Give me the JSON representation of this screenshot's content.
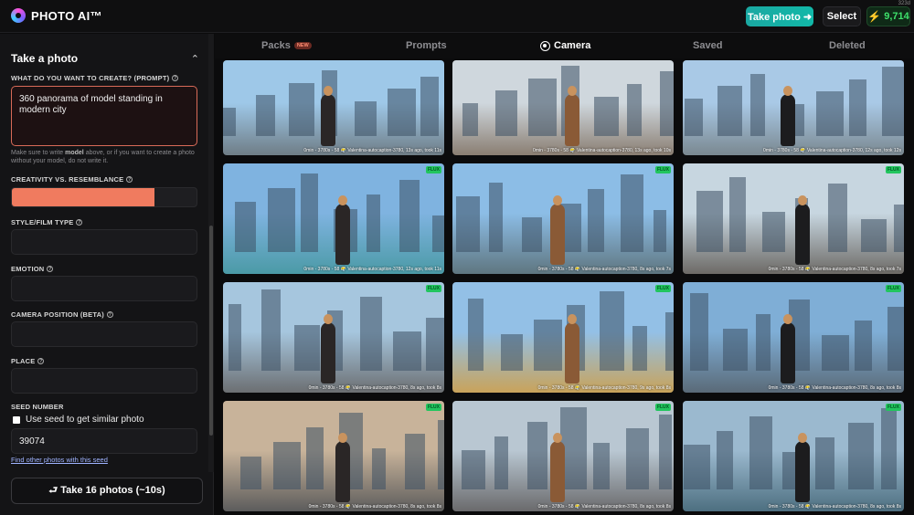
{
  "app": {
    "name": "PHOTO AI™",
    "corner_id": "323d"
  },
  "header": {
    "take_photo_label": "Take photo ➜",
    "select_label": "Select",
    "credits": "9,714"
  },
  "sidebar": {
    "panel_title": "Take a photo",
    "prompt_label": "WHAT DO YOU WANT TO CREATE? (PROMPT)",
    "prompt_value": "360 panorama of model standing in modern city",
    "prompt_hint_before": "Make sure to write ",
    "prompt_hint_bold": "model",
    "prompt_hint_after": " above, or if you want to create a photo without your model, do not write it.",
    "creativity_label": "CREATIVITY VS. RESEMBLANCE",
    "creativity_value": 0.77,
    "style_label": "STYLE/FILM TYPE",
    "style_value": "",
    "emotion_label": "EMOTION",
    "emotion_value": "",
    "camera_label": "CAMERA POSITION (BETA)",
    "camera_value": "",
    "place_label": "PLACE",
    "place_value": "",
    "seed_label": "SEED NUMBER",
    "seed_checkbox_label": "Use seed to get similar photo",
    "seed_value": "39074",
    "find_link": "Find other photos with this seed",
    "take_button": "⮐ Take 16 photos (~10s)"
  },
  "tabs": [
    {
      "label": "Packs",
      "badge": "NEW"
    },
    {
      "label": "Prompts"
    },
    {
      "label": "Camera",
      "active": true
    },
    {
      "label": "Saved"
    },
    {
      "label": "Deleted"
    }
  ],
  "tile_badge": "FLUX",
  "tiles": [
    {
      "caption": "0min - 3780s - 58 😶‍🌫️ Valentina-autocaption-3780, 13s ago, took 11s",
      "flux": false,
      "sky": "#9ec8e8",
      "ground": "#6f7d86"
    },
    {
      "caption": "0min - 3780s - 58 😶‍🌫️ Valentina-autocaption-3780, 13s ago, took 10s",
      "flux": false,
      "sky": "#cfd7dd",
      "ground": "#8a7e72"
    },
    {
      "caption": "0min - 3780s - 58 😶‍🌫️ Valentina-autocaption-3780, 12s ago, took 12s",
      "flux": false,
      "sky": "#a9c9e6",
      "ground": "#7a8890"
    },
    {
      "caption": "0min - 3780s - 58 😶‍🌫️ Valentina-autocaption-3780, 12s ago, took 11s",
      "flux": true,
      "sky": "#7fb3e0",
      "ground": "#4b9aa6"
    },
    {
      "caption": "0min - 3780s - 58 😶‍🌫️ Valentina-autocaption-3780, 8s ago, took 7s",
      "flux": true,
      "sky": "#8cbde6",
      "ground": "#5f7680"
    },
    {
      "caption": "0min - 3780s - 58 😶‍🌫️ Valentina-autocaption-3780, 8s ago, took 7s",
      "flux": true,
      "sky": "#c7d6e0",
      "ground": "#6d6a66"
    },
    {
      "caption": "0min - 3780s - 58 😶‍🌫️ Valentina-autocaption-3780, 8s ago, took 8s",
      "flux": true,
      "sky": "#a6c6de",
      "ground": "#6c6f72"
    },
    {
      "caption": "0min - 3780s - 58 😶‍🌫️ Valentina-autocaption-3780, 9s ago, took 8s",
      "flux": true,
      "sky": "#93c0e6",
      "ground": "#c9a35a"
    },
    {
      "caption": "0min - 3780s - 58 😶‍🌫️ Valentina-autocaption-3780, 8s ago, took 8s",
      "flux": true,
      "sky": "#7faed6",
      "ground": "#5a6a78"
    },
    {
      "caption": "0min - 3780s - 58 😶‍🌫️ Valentina-autocaption-3780, 8s ago, took 8s",
      "flux": true,
      "sky": "#c8b39a",
      "ground": "#5c5c5c"
    },
    {
      "caption": "0min - 3780s - 58 😶‍🌫️ Valentina-autocaption-3780, 8s ago, took 8s",
      "flux": true,
      "sky": "#b9c7d2",
      "ground": "#6a6a6c"
    },
    {
      "caption": "0min - 3780s - 58 😶‍🌫️ Valentina-autocaption-3780, 8s ago, took 8s",
      "flux": true,
      "sky": "#9bb9cf",
      "ground": "#4d6f80"
    }
  ]
}
